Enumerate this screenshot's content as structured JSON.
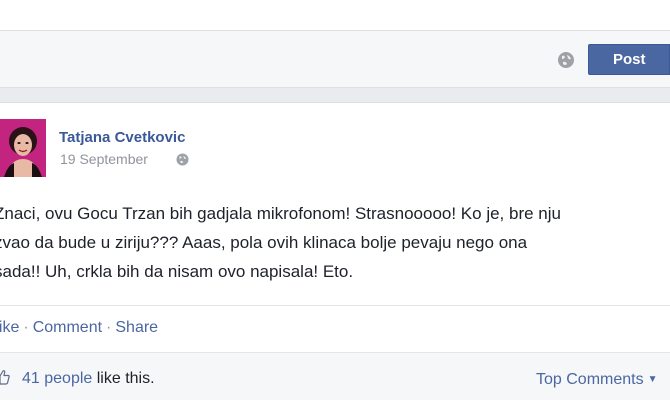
{
  "composer": {
    "post_label": "Post",
    "privacy_icon": "globe-icon"
  },
  "post": {
    "author": "Tatjana Cvetkovic",
    "date": "19 September",
    "privacy_icon": "globe-icon",
    "text_lines": [
      "Znaci, ovu Gocu Trzan bih gadjala mikrofonom! Strasnooooo! Ko je, bre nju",
      "zvao da bude u ziriju??? Aaas, pola ovih klinaca bolje pevaju nego ona",
      "sada!! Uh, crkla bih da nisam ovo napisala! Eto."
    ],
    "actions": {
      "like": "Like",
      "comment": "Comment",
      "share": "Share",
      "separator": "·"
    },
    "likes": {
      "count_label": "41 people",
      "suffix": "like this.",
      "like_icon": "thumbs-up-icon"
    },
    "sort": {
      "label": "Top Comments",
      "icon": "caret-down-icon"
    }
  },
  "colors": {
    "brand_blue": "#3b5998",
    "button_blue": "#4b67a1",
    "link_blue": "#4b67a1",
    "muted_gray": "#90949c",
    "text_dark": "#1d2129"
  }
}
